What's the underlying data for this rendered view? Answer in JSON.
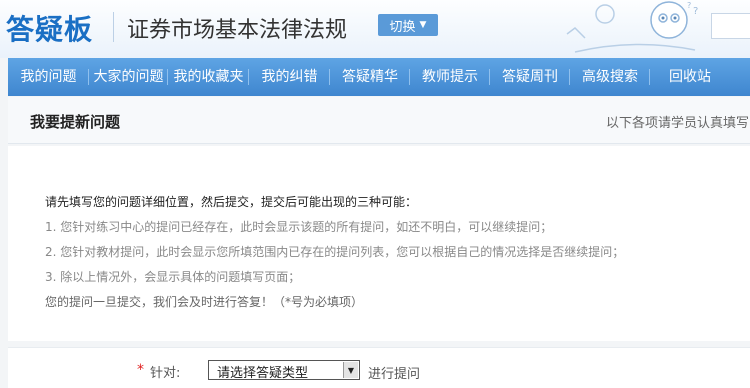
{
  "header": {
    "logo": "答疑板",
    "subject": "证券市场基本法律法规",
    "switch_label": "切换"
  },
  "nav": {
    "items": [
      {
        "label": "我的问题"
      },
      {
        "label": "大家的问题"
      },
      {
        "label": "我的收藏夹"
      },
      {
        "label": "我的纠错"
      },
      {
        "label": "答疑精华"
      },
      {
        "label": "教师提示"
      },
      {
        "label": "答疑周刊"
      },
      {
        "label": "高级搜索"
      },
      {
        "label": "回收站"
      }
    ]
  },
  "panel": {
    "title": "我要提新问题",
    "hint": "以下各项请学员认真填写，"
  },
  "notice": {
    "head": "请先填写您的问题详细位置，然后提交，提交后可能出现的三种可能：",
    "items": [
      "1. 您针对练习中心的提问已经存在，此时会显示该题的所有提问，如还不明白，可以继续提问；",
      "2. 您针对教材提问，此时会显示您所填范围内已存在的提问列表，您可以根据自己的情况选择是否继续提问；",
      "3. 除以上情况外，会显示具体的问题填写页面；"
    ],
    "tail": "您的提问一旦提交，我们会及时进行答复！（*号为必填项）"
  },
  "form": {
    "required_mark": "*",
    "label": "针对:",
    "select_value": "请选择答疑类型",
    "after_text": "进行提问"
  }
}
